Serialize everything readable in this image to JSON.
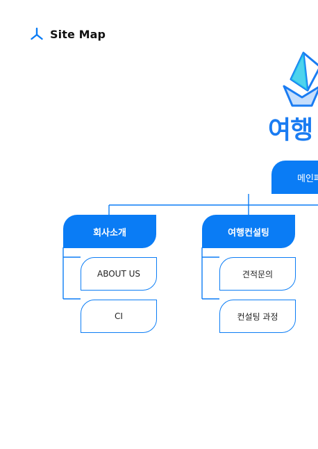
{
  "header": {
    "title": "Site Map",
    "icon": "tri-branch-icon"
  },
  "logo": {
    "text": "여행",
    "icon": "paper-boat-icon"
  },
  "root": {
    "label": "메인페이지"
  },
  "categories": [
    {
      "label": "회사소개",
      "children": [
        "ABOUT US",
        "CI"
      ]
    },
    {
      "label": "여행컨설팅",
      "children": [
        "견적문의",
        "컨설팅 과정"
      ]
    }
  ],
  "colors": {
    "accent": "#0a7cf5",
    "text": "#111111",
    "background": "#ffffff"
  }
}
